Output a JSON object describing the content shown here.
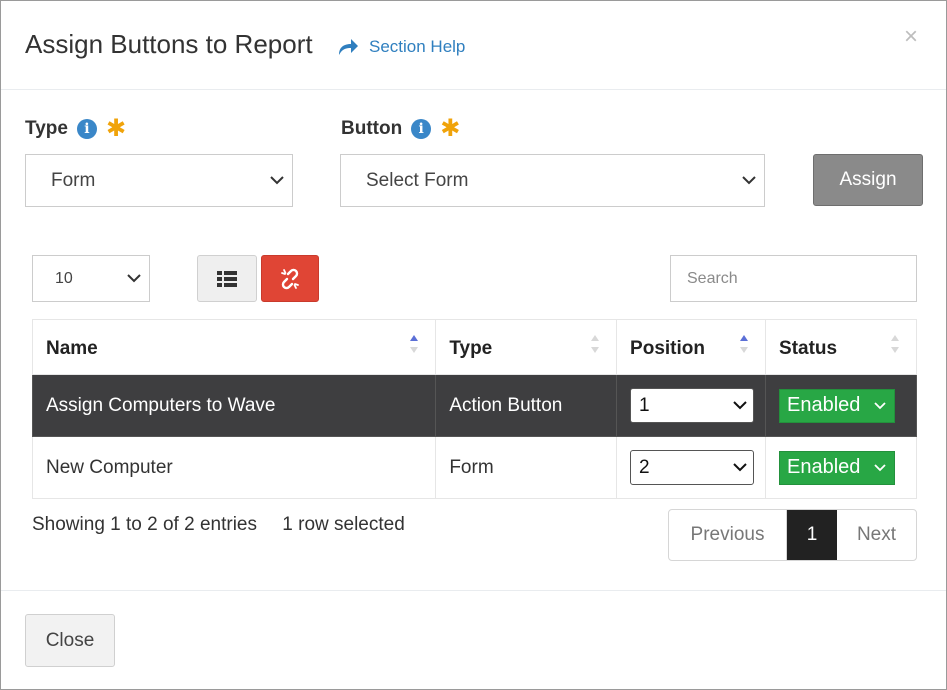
{
  "header": {
    "title": "Assign Buttons to Report",
    "help_link": "Section Help",
    "close_glyph": "×"
  },
  "form": {
    "type_label": "Type",
    "type_value": "Form",
    "button_label": "Button",
    "button_value": "Select Form",
    "info_glyph": "i",
    "required_glyph": "✱",
    "assign_label": "Assign"
  },
  "toolbar": {
    "page_length": "10",
    "search_placeholder": "Search",
    "icons": [
      "list-icon",
      "unlink-icon"
    ]
  },
  "table": {
    "columns": [
      "Name",
      "Type",
      "Position",
      "Status"
    ],
    "rows": [
      {
        "name": "Assign Computers to Wave",
        "type": "Action Button",
        "position": "1",
        "status": "Enabled",
        "selected": true
      },
      {
        "name": "New Computer",
        "type": "Form",
        "position": "2",
        "status": "Enabled",
        "selected": false
      }
    ]
  },
  "footer_info": {
    "entries": "Showing 1 to 2 of 2 entries",
    "selected": "1 row selected"
  },
  "pagination": {
    "previous": "Previous",
    "current": "1",
    "next": "Next"
  },
  "footer": {
    "close_label": "Close"
  },
  "colors": {
    "accent_blue": "#2f7fbf",
    "required_orange": "#f0a30a",
    "status_green": "#28a745",
    "danger_red": "#e04535",
    "selected_row": "#3e3e40"
  }
}
